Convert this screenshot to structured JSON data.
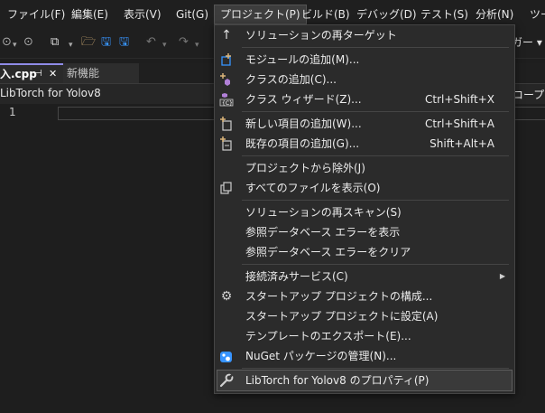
{
  "menubar": {
    "items": [
      "ファイル(F)",
      "編集(E)",
      "表示(V)",
      "Git(G)",
      "プロジェクト(P)",
      "ビルド(B)",
      "デバッグ(D)",
      "テスト(S)",
      "分析(N)",
      "ツー"
    ]
  },
  "toolbar": {
    "config_fragment": "ガー ▾"
  },
  "tabs": {
    "active_file": "入.cpp",
    "pin_glyph": "⊣",
    "close_glyph": "✕",
    "inactive_label": "新機能"
  },
  "navbar": {
    "project": "LibTorch for Yolov8",
    "scope_fragment": "コープ)"
  },
  "editor": {
    "line_number": "1"
  },
  "menu": {
    "items": {
      "retarget": {
        "label": "ソリューションの再ターゲット",
        "icon": "arrow-up-icon"
      },
      "add_module": {
        "label": "モジュールの追加(M)...",
        "icon": "add-module-icon"
      },
      "add_class": {
        "label": "クラスの追加(C)...",
        "icon": "add-class-icon"
      },
      "class_wizard": {
        "label": "クラス ウィザード(Z)...",
        "shortcut": "Ctrl+Shift+X",
        "icon": "class-wizard-icon"
      },
      "new_item": {
        "label": "新しい項目の追加(W)...",
        "shortcut": "Ctrl+Shift+A",
        "icon": "new-item-icon"
      },
      "existing_item": {
        "label": "既存の項目の追加(G)...",
        "shortcut": "Shift+Alt+A",
        "icon": "existing-item-icon"
      },
      "exclude": {
        "label": "プロジェクトから除外(J)"
      },
      "show_all": {
        "label": "すべてのファイルを表示(O)",
        "icon": "show-all-files-icon"
      },
      "rescan": {
        "label": "ソリューションの再スキャン(S)"
      },
      "show_db_errors": {
        "label": "参照データベース エラーを表示"
      },
      "clear_db_errors": {
        "label": "参照データベース エラーをクリア"
      },
      "connected_services": {
        "label": "接続済みサービス(C)"
      },
      "startup_config": {
        "label": "スタートアップ プロジェクトの構成...",
        "icon": "gear-icon"
      },
      "set_startup": {
        "label": "スタートアップ プロジェクトに設定(A)"
      },
      "export_template": {
        "label": "テンプレートのエクスポート(E)..."
      },
      "nuget": {
        "label": "NuGet パッケージの管理(N)...",
        "icon": "nuget-icon"
      },
      "properties": {
        "label": "LibTorch for Yolov8 のプロパティ(P)",
        "icon": "wrench-icon"
      }
    }
  },
  "colors": {
    "accent": "#8f8be8",
    "menu_bg": "#2b2b2b",
    "highlight_bg": "#3a3a3a",
    "icon_blue": "#3794ff",
    "icon_yellow": "#dcb67a"
  }
}
